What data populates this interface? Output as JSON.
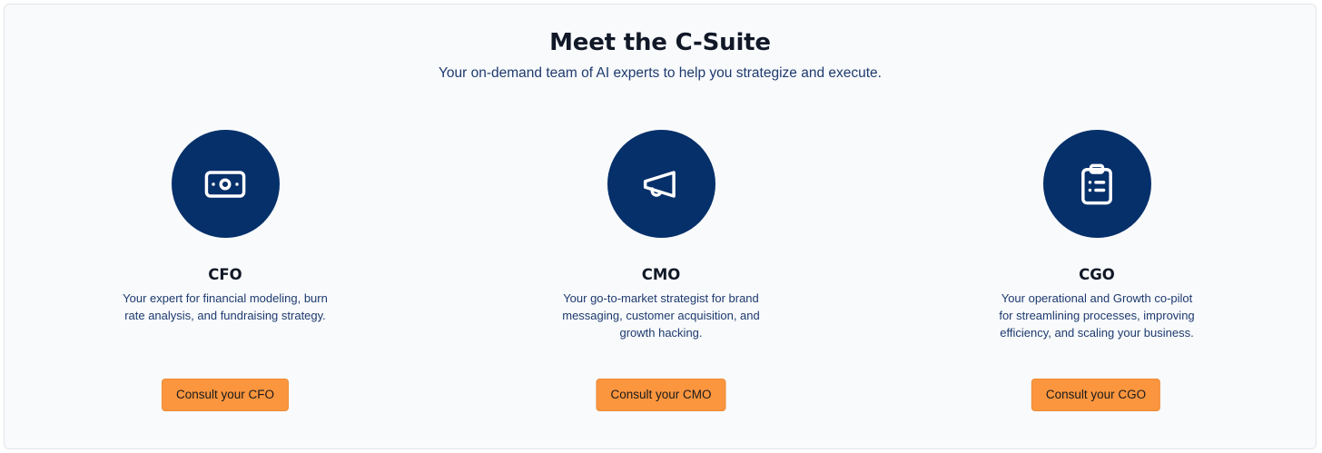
{
  "header": {
    "title": "Meet the C-Suite",
    "subtitle": "Your on-demand team of AI experts to help you strategize and execute."
  },
  "colors": {
    "icon_circle": "#06306a",
    "button": "#fb963f",
    "heading": "#111827",
    "body_text": "#1e3a6e",
    "background": "#f8fafc"
  },
  "cards": [
    {
      "icon": "money-bill-icon",
      "role": "CFO",
      "description": "Your expert for financial modeling, burn rate analysis, and fundraising strategy.",
      "button_label": "Consult your CFO"
    },
    {
      "icon": "megaphone-icon",
      "role": "CMO",
      "description": "Your go-to-market strategist for brand messaging, customer acquisition, and growth hacking.",
      "button_label": "Consult your CMO"
    },
    {
      "icon": "clipboard-list-icon",
      "role": "CGO",
      "description": "Your operational and Growth co-pilot for streamlining processes, improving efficiency, and scaling your business.",
      "button_label": "Consult your CGO"
    }
  ]
}
